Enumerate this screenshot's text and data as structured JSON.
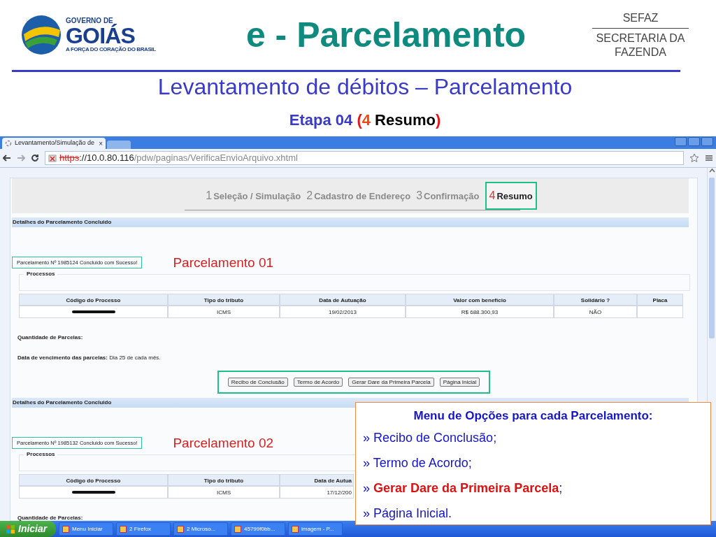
{
  "slide": {
    "logo": {
      "top": "GOVERNO DE",
      "name": "GOIÁS",
      "tagline": "A FORÇA DO CORAÇÃO DO BRASIL"
    },
    "title": "e - Parcelamento",
    "agency": {
      "short": "SEFAZ",
      "long": "SECRETARIA DA FAZENDA"
    },
    "subtitle": "Levantamento de débitos – Parcelamento",
    "step": {
      "label": "Etapa 04",
      "open": "(",
      "number": "4",
      "word": "Resumo",
      "close": ")"
    }
  },
  "browser": {
    "tab": "Levantamento/Simulação de",
    "tab_close": "×",
    "url": {
      "scheme": "https",
      "separator": "://",
      "host": "10.0.80.116",
      "path": "/pdw/paginas/VerificaEnvioArquivo.xhtml"
    }
  },
  "wizard": [
    {
      "number": "1",
      "label": "Seleção / Simulação",
      "selected": false
    },
    {
      "number": "2",
      "label": "Cadastro de Endereço",
      "selected": false
    },
    {
      "number": "3",
      "label": "Confirmação",
      "selected": false
    },
    {
      "number": "4",
      "label": "Resumo",
      "selected": true
    }
  ],
  "parcelamentos": [
    {
      "header": "Detalhes do Parcelamento Concluido",
      "message": "Parcelamento Nº 1985124 Concluido com Sucesso!",
      "callout": "Parcelamento 01",
      "fieldset": "Processos",
      "columns": [
        "Código do Processo",
        "Tipo do tributo",
        "Data de Autuação",
        "Valor com benefício",
        "Solidário ?",
        "Placa"
      ],
      "row": [
        "ICMS",
        "19/02/2013",
        "R$ 688.300,93",
        "NÃO"
      ],
      "quantidade_label": "Quantidade de Parcelas:",
      "vencimento_label": "Data de vencimento das parcelas:",
      "vencimento_value": "Dia 25 de cada mês.",
      "buttons": [
        "Recibo de Conclusão",
        "Termo de Acordo",
        "Gerar Dare da Primeira Parcela",
        "Página Inicial"
      ]
    },
    {
      "header": "Detalhes do Parcelamento Concluido",
      "message": "Parcelamento Nº 1985132 Concluido com Sucesso!",
      "callout": "Parcelamento 02",
      "fieldset": "Processos",
      "columns": [
        "Código do Processo",
        "Tipo do tributo",
        "Data de Autua"
      ],
      "row": [
        "ICMS",
        "17/12/200"
      ],
      "quantidade_label": "Quantidade de Parcelas:"
    }
  ],
  "menu_note": {
    "title": "Menu de Opções para cada Parcelamento:",
    "items": [
      {
        "marker": "»",
        "text": "Recibo de Conclusão",
        "suffix": ";",
        "highlighted": false
      },
      {
        "marker": "»",
        "text": "Termo de Acordo",
        "suffix": ";",
        "highlighted": false
      },
      {
        "marker": "»",
        "text": "Gerar Dare da Primeira Parcela",
        "suffix": ";",
        "highlighted": true
      },
      {
        "marker": "»",
        "text": "Página Inicial",
        "suffix": ".",
        "highlighted": false
      }
    ]
  },
  "taskbar": {
    "start": "Iniciar",
    "items": [
      "Menu Iniciar",
      "2 Firefox",
      "2 Microso...",
      "45799f0bb...",
      "imagem - P..."
    ]
  }
}
